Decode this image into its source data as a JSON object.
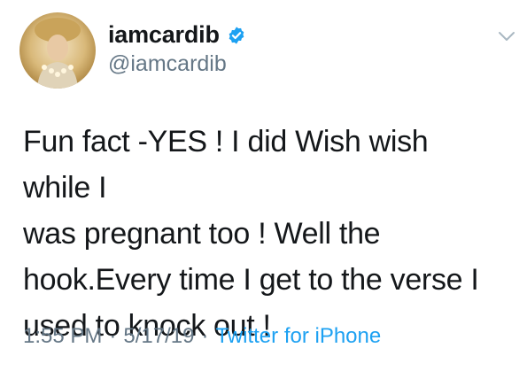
{
  "tweet": {
    "author": {
      "display_name": "iamcardib",
      "handle": "@iamcardib",
      "verified": true
    },
    "text": "Fun fact -YES ! I did Wish wish while I\nwas pregnant too ! Well the\nhook.Every time  I get to the verse I\nused to knock out !",
    "meta": {
      "time": "1:55 PM",
      "separator": "·",
      "date": "5/17/19",
      "source": "Twitter for iPhone"
    }
  },
  "icons": {
    "verified": "verified-badge-icon",
    "caret": "chevron-down-icon"
  },
  "colors": {
    "accent": "#1da1f2",
    "text": "#14171a",
    "muted": "#657786"
  }
}
